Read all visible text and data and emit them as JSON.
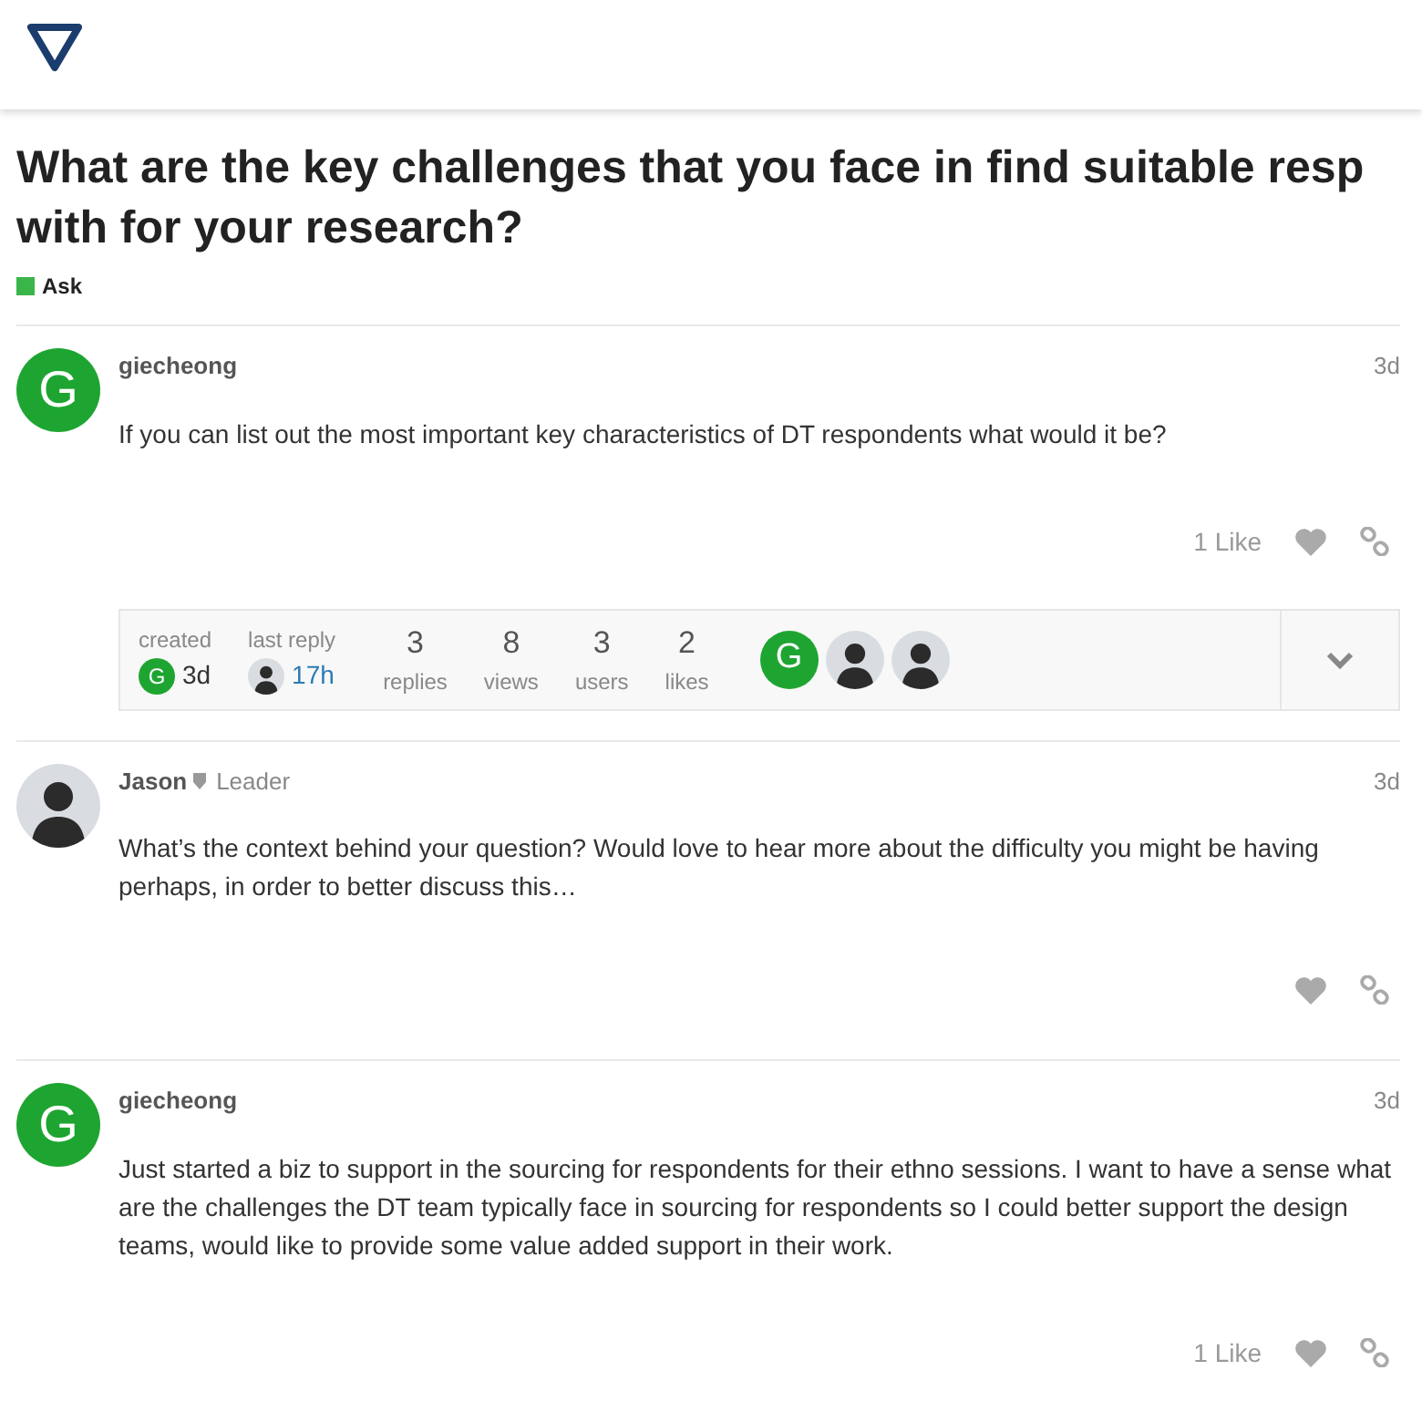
{
  "title_lines": [
    "What are the key challenges that you face in find suitable resp",
    "with for your research?"
  ],
  "category": {
    "name": "Ask",
    "color": "#3ab54a"
  },
  "posts": [
    {
      "avatar": {
        "kind": "letter",
        "letter": "G",
        "color": "#1ea531"
      },
      "username": "giecheong",
      "date": "3d",
      "body": "If you can list out the most important key characteristics of DT respondents what would it be?",
      "likes": "1 Like",
      "summary": {
        "created_label": "created",
        "created_avatar": {
          "kind": "letter",
          "letter": "G",
          "color": "#1ea531"
        },
        "created": "3d",
        "last_reply_label": "last reply",
        "last_reply_avatar": {
          "kind": "photo"
        },
        "last_reply": "17h",
        "stats": [
          {
            "value": "3",
            "label": "replies"
          },
          {
            "value": "8",
            "label": "views"
          },
          {
            "value": "3",
            "label": "users"
          },
          {
            "value": "2",
            "label": "likes"
          }
        ],
        "participants": [
          {
            "kind": "letter",
            "letter": "G",
            "color": "#1ea531"
          },
          {
            "kind": "photo"
          },
          {
            "kind": "photo"
          }
        ]
      }
    },
    {
      "avatar": {
        "kind": "photo"
      },
      "username": "Jason",
      "user_title": "Leader",
      "date": "3d",
      "body": "What’s the context behind your question? Would love to hear more about the difficulty you might be having perhaps, in order to better discuss this…"
    },
    {
      "avatar": {
        "kind": "letter",
        "letter": "G",
        "color": "#1ea531"
      },
      "username": "giecheong",
      "date": "3d",
      "body": "Just started a biz to support in the sourcing for respondents for their ethno sessions. I want to have a sense what are the challenges the DT team typically face in sourcing for respondents so I could better support the design teams, would like to provide some value added support in their work.",
      "likes": "1 Like"
    }
  ]
}
